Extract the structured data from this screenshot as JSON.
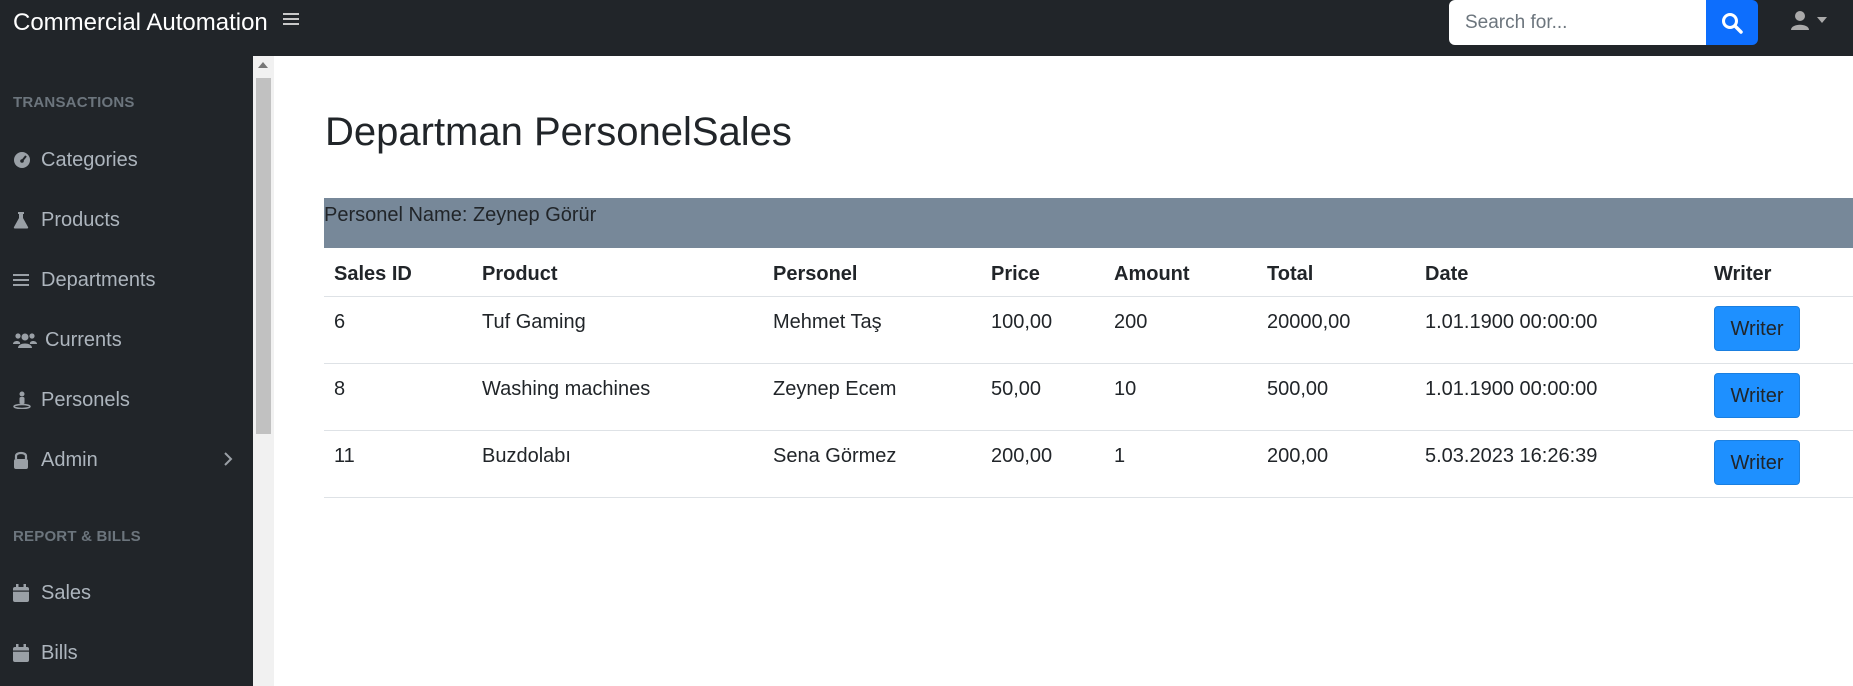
{
  "navbar": {
    "brand": "Commercial Automation",
    "search_placeholder": "Search for...",
    "icons": {
      "toggle": "bars-icon",
      "search": "search-icon",
      "user": "user-icon",
      "caret": "caret-down-icon"
    }
  },
  "sidebar": {
    "heading_transactions": "TRANSACTIONS",
    "items": [
      {
        "label": "Categories",
        "icon": "tachometer-icon"
      },
      {
        "label": "Products",
        "icon": "flask-icon"
      },
      {
        "label": "Departments",
        "icon": "bars-icon"
      },
      {
        "label": "Currents",
        "icon": "users-icon"
      },
      {
        "label": "Personels",
        "icon": "street-view-icon"
      },
      {
        "label": "Admin",
        "icon": "lock-icon"
      }
    ],
    "heading_reports": "REPORT & BILLS",
    "report_items": [
      {
        "label": "Sales",
        "icon": "calendar-icon"
      },
      {
        "label": "Bills",
        "icon": "calendar-icon"
      }
    ]
  },
  "main": {
    "title": "Departman PersonelSales",
    "personel_name": "Personel Name: Zeynep Görür",
    "table": {
      "headers": [
        "Sales ID",
        "Product",
        "Personel",
        "Price",
        "Amount",
        "Total",
        "Date",
        "Writer"
      ],
      "rows": [
        {
          "id": "6",
          "product": "Tuf Gaming",
          "personel": "Mehmet Taş",
          "price": "100,00",
          "amount": "200",
          "total": "20000,00",
          "date": "1.01.1900 00:00:00",
          "button": "Writer"
        },
        {
          "id": "8",
          "product": "Washing machines",
          "personel": "Zeynep Ecem",
          "price": "50,00",
          "amount": "10",
          "total": "500,00",
          "date": "1.01.1900 00:00:00",
          "button": "Writer"
        },
        {
          "id": "11",
          "product": "Buzdolabı",
          "personel": "Sena Görmez",
          "price": "200,00",
          "amount": "1",
          "total": "200,00",
          "date": "5.03.2023 16:26:39",
          "button": "Writer"
        }
      ]
    }
  },
  "colors": {
    "navbar_bg": "#212529",
    "accent": "#0d6efd",
    "writer_button": "#1e90ff",
    "info_bar": "#778899"
  }
}
